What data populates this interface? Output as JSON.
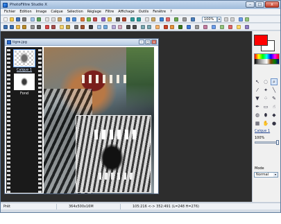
{
  "window": {
    "title": "PhotoFiltre Studio X",
    "buttons": {
      "minimize": "–",
      "maximize": "□",
      "close": "x"
    }
  },
  "menu": [
    "Fichier",
    "Edition",
    "Image",
    "Calque",
    "Sélection",
    "Réglage",
    "Filtre",
    "Affichage",
    "Outils",
    "Fenêtre",
    "?"
  ],
  "toolbar": {
    "zoom_value": "100%",
    "zoom_arrow": "▾"
  },
  "document": {
    "title": "tigre.jpg",
    "buttons": {
      "minimize": "–",
      "maximize": "□",
      "close": "x"
    },
    "layers": [
      {
        "label": "Calque 1",
        "selected": true
      },
      {
        "label": "Fond",
        "selected": false
      }
    ]
  },
  "colors": {
    "foreground": "#ff0000",
    "background": "#ffffff",
    "workspace": "#2d2d2d"
  },
  "tools": [
    {
      "name": "select-arrow-icon",
      "glyph": "↖"
    },
    {
      "name": "lasso-icon",
      "glyph": "◌"
    },
    {
      "name": "zoom-icon",
      "glyph": "⌕"
    },
    {
      "name": "pipette-icon",
      "glyph": "⁄"
    },
    {
      "name": "magic-wand-icon",
      "glyph": "✦"
    },
    {
      "name": "line-icon",
      "glyph": "╲"
    },
    {
      "name": "bucket-icon",
      "glyph": "▼"
    },
    {
      "name": "spray-icon",
      "glyph": "⁘"
    },
    {
      "name": "brush-icon",
      "glyph": "✎"
    },
    {
      "name": "pen-icon",
      "glyph": "✒"
    },
    {
      "name": "eraser-icon",
      "glyph": "▭"
    },
    {
      "name": "smudge-icon",
      "glyph": "☝"
    },
    {
      "name": "blur-icon",
      "glyph": "◍"
    },
    {
      "name": "stamp-icon",
      "glyph": "⬮"
    },
    {
      "name": "shape-icon",
      "glyph": "◆"
    },
    {
      "name": "pattern-icon",
      "glyph": "▦"
    },
    {
      "name": "hand-icon",
      "glyph": "✋"
    },
    {
      "name": "red-eye-icon",
      "glyph": "●"
    }
  ],
  "layer_panel": {
    "name": "Calque 1",
    "opacity": "100%",
    "opacity_value": 1.0,
    "mode_label": "Mode",
    "mode_value": "Normal",
    "mode_arrow": "▾"
  },
  "status": {
    "state": "Prêt",
    "dimensions": "364x500x16M",
    "coordinates": "105:216 <-> 352:491 (L=248 H=276)"
  }
}
